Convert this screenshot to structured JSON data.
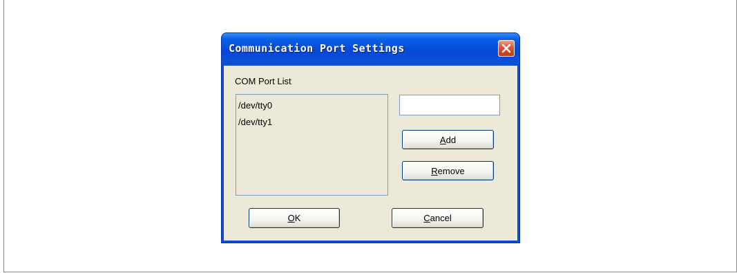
{
  "dialog": {
    "title": "Communication Port Settings",
    "close_icon": "close-icon"
  },
  "com_ports": {
    "label": "COM Port List",
    "items": [
      "/dev/tty0",
      "/dev/tty1"
    ],
    "new_port_value": ""
  },
  "buttons": {
    "add": {
      "mnemonic": "A",
      "rest": "dd"
    },
    "remove": {
      "mnemonic": "R",
      "rest": "emove"
    },
    "ok": {
      "mnemonic": "O",
      "rest": "K"
    },
    "cancel": {
      "mnemonic": "C",
      "rest": "ancel"
    }
  },
  "colors": {
    "titlebar": "#0a4bd8",
    "client": "#ece9d8",
    "close": "#e0502f"
  }
}
